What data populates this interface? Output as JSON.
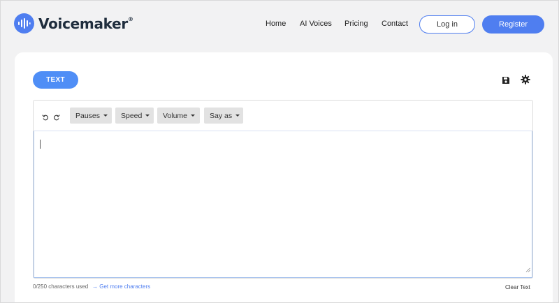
{
  "brand": {
    "name": "Voicemaker",
    "mark": "®",
    "color": "#4f7ef0"
  },
  "nav": {
    "items": [
      "Home",
      "AI Voices",
      "Pricing",
      "Contact"
    ],
    "login_label": "Log in",
    "register_label": "Register"
  },
  "editor": {
    "mode_tab": "TEXT",
    "toolbar": {
      "dropdowns": [
        "Pauses",
        "Speed",
        "Volume",
        "Say as"
      ]
    },
    "text_value": "",
    "char_count": "0/250 characters used",
    "more_chars_link": "→ Get more characters",
    "clear_label": "Clear Text"
  },
  "icons": {
    "save": "save-icon",
    "settings": "gear-icon",
    "undo": "undo-icon",
    "redo": "redo-icon"
  },
  "colors": {
    "accent": "#4f7ef0",
    "tab": "#4f8ef6",
    "background": "#f2f2f3",
    "toolbar_button": "#e2e2e2"
  }
}
